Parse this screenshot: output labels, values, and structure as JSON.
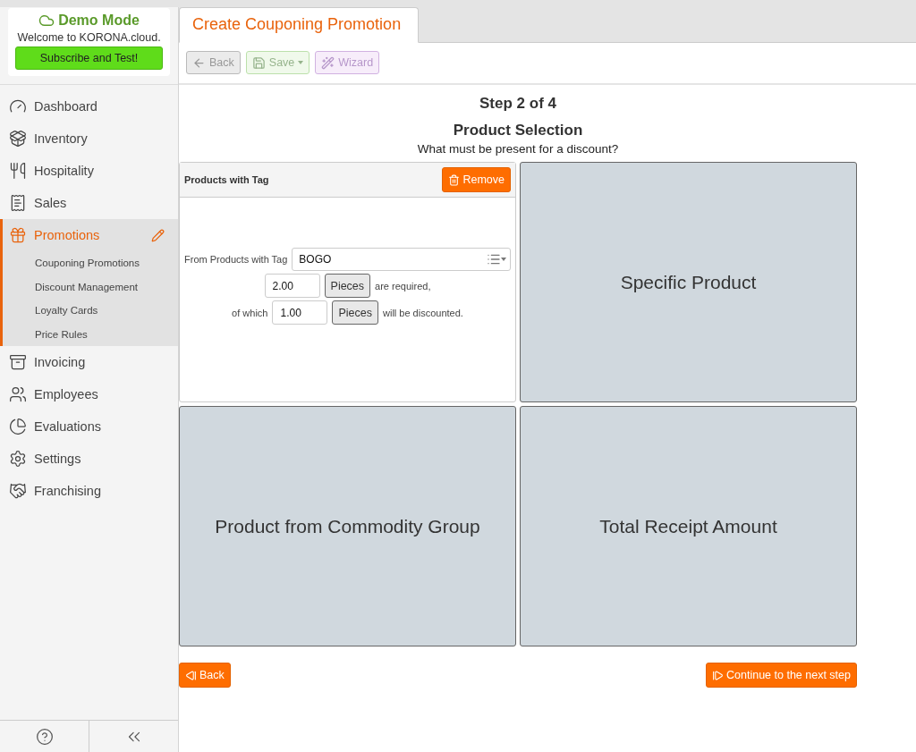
{
  "demo": {
    "title": "Demo Mode",
    "welcome": "Welcome to KORONA.cloud.",
    "subscribe": "Subscribe and Test!"
  },
  "nav": [
    {
      "label": "Dashboard",
      "selected": false
    },
    {
      "label": "Inventory",
      "selected": false
    },
    {
      "label": "Hospitality",
      "selected": false
    },
    {
      "label": "Sales",
      "selected": false
    },
    {
      "label": "Promotions",
      "selected": true,
      "children": [
        {
          "label": "Couponing Promotions"
        },
        {
          "label": "Discount Management"
        },
        {
          "label": "Loyalty Cards"
        },
        {
          "label": "Price Rules"
        }
      ]
    },
    {
      "label": "Invoicing",
      "selected": false
    },
    {
      "label": "Employees",
      "selected": false
    },
    {
      "label": "Evaluations",
      "selected": false
    },
    {
      "label": "Settings",
      "selected": false
    },
    {
      "label": "Franchising",
      "selected": false
    }
  ],
  "tab": {
    "title": "Create Couponing Promotion"
  },
  "toolbar": [
    {
      "kind": "back",
      "label": "Back",
      "disabled": true
    },
    {
      "kind": "save",
      "label": "Save",
      "disabled": true
    },
    {
      "kind": "wizard",
      "label": "Wizard",
      "disabled": true
    }
  ],
  "step": {
    "step": "Step 2 of 4",
    "title": "Product Selection",
    "subtitle": "What must be present for a discount?"
  },
  "tiles": [
    {
      "kind": "form",
      "title": "Products with Tag",
      "remove": "Remove",
      "tag_label": "From Products with Tag",
      "tag_value": "BOGO",
      "required_qty": "2.00",
      "required_unit": "Pieces",
      "required_text": "are required,",
      "of_which": "of which",
      "discount_qty": "1.00",
      "discount_unit": "Pieces",
      "discount_text": "will be discounted."
    },
    {
      "kind": "option",
      "label": "Specific Product"
    },
    {
      "kind": "option",
      "label": "Product from Commodity Group"
    },
    {
      "kind": "option",
      "label": "Total Receipt Amount"
    }
  ],
  "footer": {
    "back": "Back",
    "next": "Continue to the next step"
  }
}
